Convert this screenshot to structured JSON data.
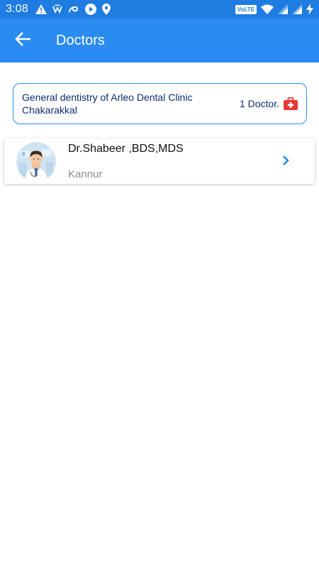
{
  "status_bar": {
    "time": "3:08",
    "network_label": "VoLTE"
  },
  "app_bar": {
    "title": "Doctors"
  },
  "department": {
    "name": "General dentistry of Arleo Dental Clinic Chakarakkal",
    "doctor_count": "1 Doctor."
  },
  "doctors": [
    {
      "name": "Dr.Shabeer ,BDS,MDS",
      "location": "Kannur"
    }
  ],
  "colors": {
    "status_bar": "#1f7ce0",
    "app_bar": "#2a8bf0",
    "accent": "#2a8bf0",
    "text_dark_blue": "#0d2c6e",
    "kit_red": "#e53935"
  },
  "icons": {
    "back": "arrow-back-icon",
    "kit": "first-aid-kit-icon",
    "chevron": "chevron-right-icon"
  }
}
